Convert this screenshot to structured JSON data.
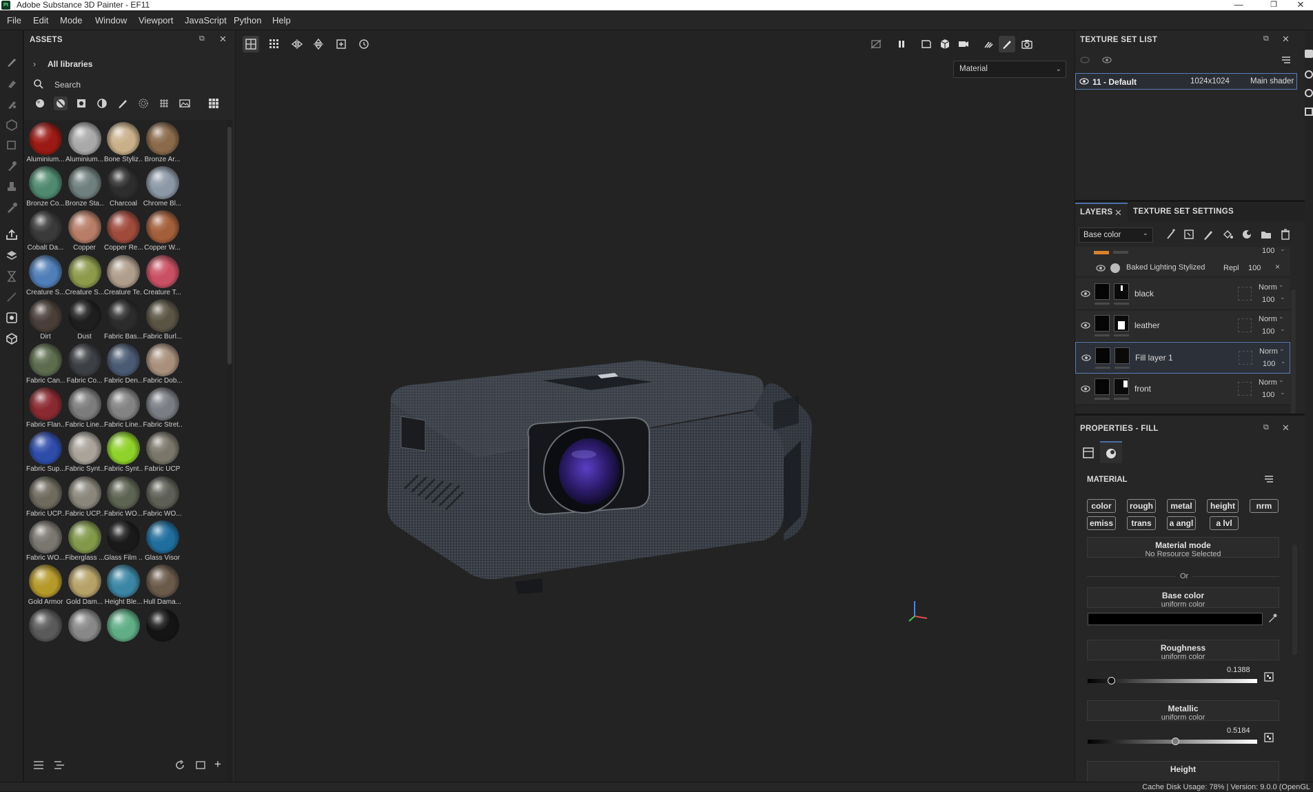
{
  "window": {
    "app_icon": "Pt",
    "title": "Adobe Substance 3D Painter - EF11",
    "controls": [
      "minimize-icon",
      "restore-icon",
      "close-icon"
    ]
  },
  "menu": [
    "File",
    "Edit",
    "Mode",
    "Window",
    "Viewport",
    "JavaScript",
    "Python",
    "Help"
  ],
  "assets": {
    "title": "ASSETS",
    "library": "All libraries",
    "search_placeholder": "Search",
    "materials": [
      {
        "label": "Aluminium...",
        "color": "#9c1a14"
      },
      {
        "label": "Aluminium...",
        "color": "#a9a9a9"
      },
      {
        "label": "Bone Styliz...",
        "color": "#c9b08a"
      },
      {
        "label": "Bronze Ar...",
        "color": "#8a6a4a"
      },
      {
        "label": "Bronze Co...",
        "color": "#4f8a70"
      },
      {
        "label": "Bronze Sta...",
        "color": "#6f7f7d"
      },
      {
        "label": "Charcoal",
        "color": "#2d2d2d"
      },
      {
        "label": "Chrome Bl...",
        "color": "#8c98a6"
      },
      {
        "label": "Cobalt Da...",
        "color": "#3a3a3a"
      },
      {
        "label": "Copper",
        "color": "#b77d67"
      },
      {
        "label": "Copper Re...",
        "color": "#a04a3c"
      },
      {
        "label": "Copper W...",
        "color": "#a35f3a"
      },
      {
        "label": "Creature S...",
        "color": "#4f7eb8"
      },
      {
        "label": "Creature S...",
        "color": "#8c9a4a"
      },
      {
        "label": "Creature Te...",
        "color": "#b09e8c"
      },
      {
        "label": "Creature T...",
        "color": "#c95062"
      },
      {
        "label": "Dirt",
        "color": "#4a3f38"
      },
      {
        "label": "Dust",
        "color": "#1e1e1e"
      },
      {
        "label": "Fabric Bas...",
        "color": "#2c2c2c"
      },
      {
        "label": "Fabric Burl...",
        "color": "#5a5444"
      },
      {
        "label": "Fabric Can...",
        "color": "#5c6c4c"
      },
      {
        "label": "Fabric Co...",
        "color": "#3c3f44"
      },
      {
        "label": "Fabric Den...",
        "color": "#4a5a72"
      },
      {
        "label": "Fabric Dob...",
        "color": "#a8907c"
      },
      {
        "label": "Fabric Flan...",
        "color": "#8a2a30"
      },
      {
        "label": "Fabric Line...",
        "color": "#7c7c7c"
      },
      {
        "label": "Fabric Line...",
        "color": "#838383"
      },
      {
        "label": "Fabric Stret...",
        "color": "#7a7e84"
      },
      {
        "label": "Fabric Sup...",
        "color": "#2e4caa"
      },
      {
        "label": "Fabric Synt...",
        "color": "#a9a39a"
      },
      {
        "label": "Fabric Synt...",
        "color": "#8fd22a"
      },
      {
        "label": "Fabric UCP",
        "color": "#7a766a"
      },
      {
        "label": "Fabric UCP...",
        "color": "#6e6a5e"
      },
      {
        "label": "Fabric UCP...",
        "color": "#8a867c"
      },
      {
        "label": "Fabric WO...",
        "color": "#5e6452"
      },
      {
        "label": "Fabric WO...",
        "color": "#5e6056"
      },
      {
        "label": "Fabric WO...",
        "color": "#7a7670"
      },
      {
        "label": "Fiberglass ...",
        "color": "#82994a"
      },
      {
        "label": "Glass Film ...",
        "color": "#1a1a1a"
      },
      {
        "label": "Glass Visor",
        "color": "#1f6e9e"
      },
      {
        "label": "Gold Armor",
        "color": "#b59a2a"
      },
      {
        "label": "Gold Dam...",
        "color": "#b6a268"
      },
      {
        "label": "Height Ble...",
        "color": "#3b86a4"
      },
      {
        "label": "Hull Dama...",
        "color": "#6a5a4a"
      },
      {
        "label": "",
        "color": "#5a5a5a"
      },
      {
        "label": "",
        "color": "#888888"
      },
      {
        "label": "",
        "color": "#5fae86"
      },
      {
        "label": "",
        "color": "#141414"
      }
    ]
  },
  "viewport": {
    "display_mode": "Material"
  },
  "texture_set_list": {
    "title": "TEXTURE SET LIST",
    "row": {
      "name": "11 - Default",
      "resolution": "1024x1024",
      "shader": "Main shader"
    }
  },
  "layers": {
    "tab_active": "LAYERS",
    "tab_other": "TEXTURE SET SETTINGS",
    "channel": "Base color",
    "top_opacity": "100",
    "effect": {
      "name": "Baked Lighting Stylized",
      "blend": "Repl",
      "opacity": "100"
    },
    "items": [
      {
        "name": "black",
        "blend": "Norm",
        "opacity": "100"
      },
      {
        "name": "leather",
        "blend": "Norm",
        "opacity": "100"
      },
      {
        "name": "Fill layer 1",
        "blend": "Norm",
        "opacity": "100"
      },
      {
        "name": "front",
        "blend": "Norm",
        "opacity": "100"
      }
    ]
  },
  "properties": {
    "title": "PROPERTIES - FILL",
    "section": "MATERIAL",
    "channels_row1": [
      "color",
      "rough",
      "metal",
      "height",
      "nrm"
    ],
    "channels_row2": [
      "emiss",
      "trans",
      "a angl",
      "a lvl"
    ],
    "material_mode": {
      "title": "Material mode",
      "sub": "No Resource Selected"
    },
    "or": "Or",
    "base_color": {
      "title": "Base color",
      "sub": "uniform color",
      "color": "#000000"
    },
    "roughness": {
      "title": "Roughness",
      "sub": "uniform color",
      "value": "0.1388",
      "fraction": 0.1388
    },
    "metallic": {
      "title": "Metallic",
      "sub": "uniform color",
      "value": "0.5184",
      "fraction": 0.5184
    },
    "height": {
      "title": "Height"
    }
  },
  "status": "Cache Disk Usage:   78% | Version: 9.0.0 (OpenGL"
}
